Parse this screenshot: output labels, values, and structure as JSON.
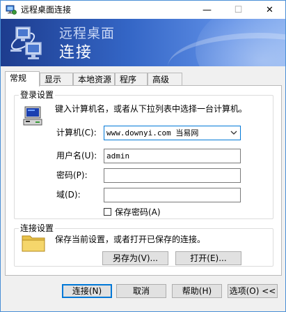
{
  "window": {
    "title": "远程桌面连接",
    "min_symbol": "—",
    "max_symbol": "☐",
    "close_symbol": "✕"
  },
  "banner": {
    "line1": "远程桌面",
    "line2": "连接"
  },
  "tabs": [
    {
      "label": "常规",
      "active": true
    },
    {
      "label": "显示",
      "active": false
    },
    {
      "label": "本地资源",
      "active": false
    },
    {
      "label": "程序",
      "active": false
    },
    {
      "label": "高级",
      "active": false
    }
  ],
  "login": {
    "group_title": "登录设置",
    "instruction": "键入计算机名，或者从下拉列表中选择一台计算机。",
    "computer_label": "计算机(C):",
    "computer_value": "www.downyi.com  当易网",
    "username_label": "用户名(U):",
    "username_value": "admin",
    "password_label": "密码(P):",
    "password_value": "",
    "domain_label": "域(D):",
    "domain_value": "",
    "save_password_label": "保存密码(A)",
    "save_password_checked": false
  },
  "connection": {
    "group_title": "连接设置",
    "instruction": "保存当前设置，或者打开已保存的连接。",
    "save_as_label": "另存为(V)...",
    "open_label": "打开(E)..."
  },
  "footer": {
    "connect_label": "连接(N)",
    "cancel_label": "取消",
    "help_label": "帮助(H)",
    "options_label": "选项(O) <<"
  },
  "icons": {
    "app": "remote-desktop-icon",
    "banner": "remote-desktop-logo-icon",
    "computer": "computer-icon",
    "folder": "folder-icon",
    "dropdown": "chevron-down-icon"
  },
  "colors": {
    "accent": "#0078d7",
    "banner_dark": "#1d3c8e",
    "banner_light": "#7fa9ef",
    "folder": "#f5d66b"
  }
}
